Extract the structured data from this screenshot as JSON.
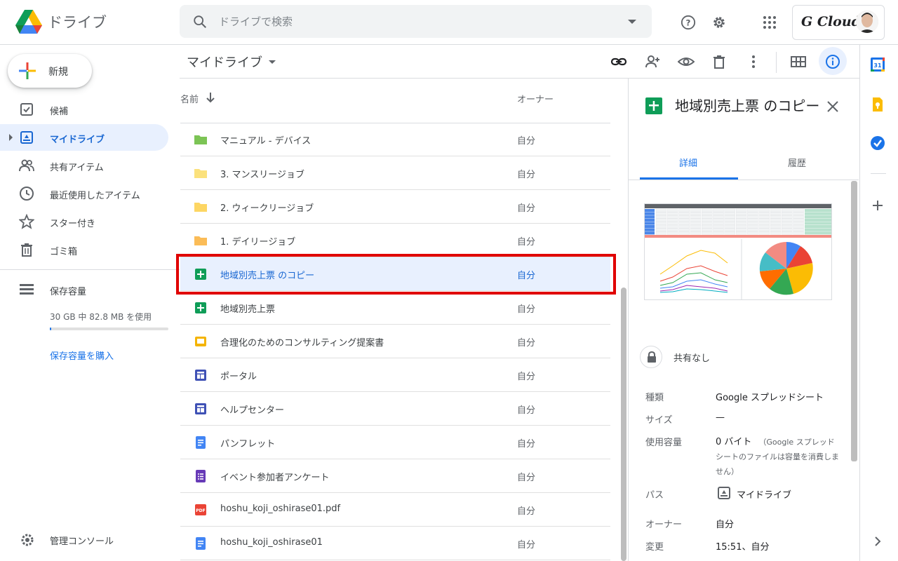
{
  "app": {
    "title": "ドライブ"
  },
  "search": {
    "placeholder": "ドライブで検索"
  },
  "account": {
    "brand": "G Cloud"
  },
  "new_button": {
    "label": "新規"
  },
  "sidebar": {
    "items": [
      {
        "label": "候補",
        "icon": "check-box-icon"
      },
      {
        "label": "マイドライブ",
        "icon": "my-drive-icon"
      },
      {
        "label": "共有アイテム",
        "icon": "people-icon"
      },
      {
        "label": "最近使用したアイテム",
        "icon": "clock-icon"
      },
      {
        "label": "スター付き",
        "icon": "star-icon"
      },
      {
        "label": "ゴミ箱",
        "icon": "trash-icon"
      }
    ],
    "storage_label": "保存容量",
    "storage_used": "30 GB 中 82.8 MB を使用",
    "storage_fraction": 0.003,
    "buy_storage": "保存容量を購入",
    "admin_console": "管理コンソール"
  },
  "main": {
    "breadcrumb": "マイドライブ",
    "columns": {
      "name": "名前",
      "owner": "オーナー"
    },
    "files": [
      {
        "name": "マニュアル - デバイス",
        "owner": "自分",
        "type": "folder",
        "color": "#7cc455"
      },
      {
        "name": "3. マンスリージョブ",
        "owner": "自分",
        "type": "folder",
        "color": "#fbe17c"
      },
      {
        "name": "2. ウィークリージョブ",
        "owner": "自分",
        "type": "folder",
        "color": "#fdd663"
      },
      {
        "name": "1. デイリージョブ",
        "owner": "自分",
        "type": "folder",
        "color": "#fbbc57"
      },
      {
        "name": "地域別売上票 のコピー",
        "owner": "自分",
        "type": "sheets",
        "selected": true
      },
      {
        "name": "地域別売上票",
        "owner": "自分",
        "type": "sheets"
      },
      {
        "name": "合理化のためのコンサルティング提案書",
        "owner": "自分",
        "type": "slides"
      },
      {
        "name": "ポータル",
        "owner": "自分",
        "type": "sites"
      },
      {
        "name": "ヘルプセンター",
        "owner": "自分",
        "type": "sites"
      },
      {
        "name": "パンフレット",
        "owner": "自分",
        "type": "docs"
      },
      {
        "name": "イベント参加者アンケート",
        "owner": "自分",
        "type": "forms"
      },
      {
        "name": "hoshu_koji_oshirase01.pdf",
        "owner": "自分",
        "type": "pdf"
      },
      {
        "name": "hoshu_koji_oshirase01",
        "owner": "自分",
        "type": "docs"
      }
    ]
  },
  "details": {
    "title": "地域別売上票 のコピー",
    "tabs": [
      "詳細",
      "履歴"
    ],
    "sharing": "共有なし",
    "props": {
      "type_label": "種類",
      "type_value": "Google スプレッドシート",
      "size_label": "サイズ",
      "size_value": "—",
      "usage_label": "使用容量",
      "usage_value": "0 バイト",
      "usage_note": "（Google スプレッドシートのファイルは容量を消費しません）",
      "path_label": "パス",
      "path_value": "マイドライブ",
      "owner_label": "オーナー",
      "owner_value": "自分",
      "modified_label": "変更",
      "modified_value": "15:51、自分"
    }
  },
  "colors": {
    "accent": "#1a73e8",
    "selected_bg": "#e8f0fe",
    "highlight": "#e00000"
  }
}
